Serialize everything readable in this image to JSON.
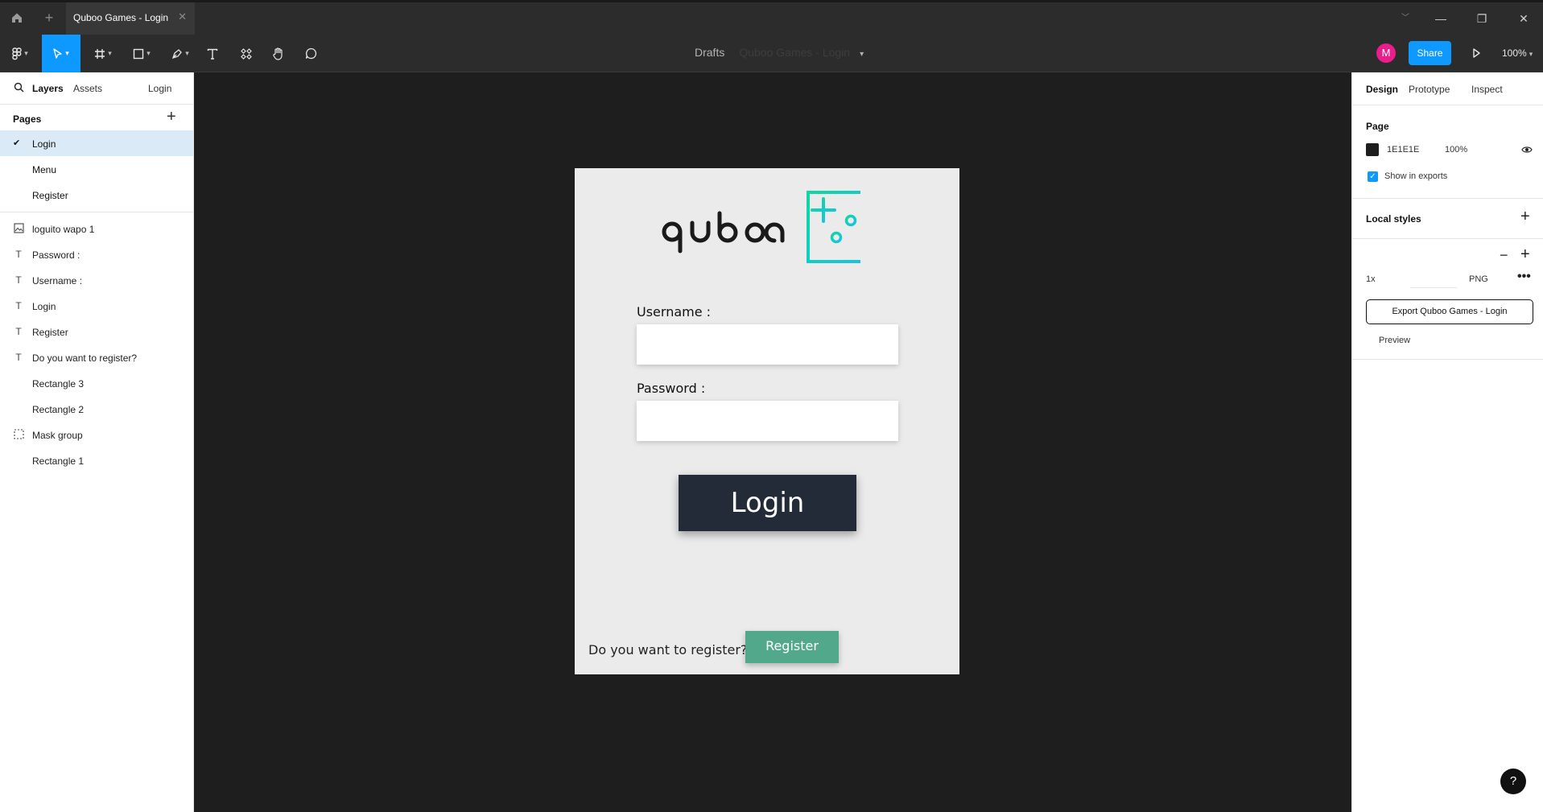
{
  "titlebar": {
    "tab_title": "Quboo Games - Login",
    "tab_close": "✕",
    "new_tab": "+",
    "minimize": "—",
    "restore": "❐",
    "close": "✕"
  },
  "toolbar": {
    "breadcrumb": "Drafts",
    "file_name": "Quboo Games - Login",
    "avatar_initial": "M",
    "share_label": "Share",
    "zoom": "100%"
  },
  "left_panel": {
    "tabs": {
      "layers": "Layers",
      "assets": "Assets",
      "page": "Login"
    },
    "pages_header": "Pages",
    "pages": [
      {
        "label": "Login",
        "selected": true
      },
      {
        "label": "Menu"
      },
      {
        "label": "Register"
      }
    ],
    "layers": [
      {
        "label": "loguito wapo 1",
        "icon": "image-icon"
      },
      {
        "label": "Password :",
        "icon": "text-icon"
      },
      {
        "label": "Username :",
        "icon": "text-icon"
      },
      {
        "label": "Login",
        "icon": "text-icon"
      },
      {
        "label": "Register",
        "icon": "text-icon"
      },
      {
        "label": "Do you want to register?",
        "icon": "text-icon"
      },
      {
        "label": "Rectangle 3",
        "icon": ""
      },
      {
        "label": "Rectangle 2",
        "icon": ""
      },
      {
        "label": "Mask group",
        "icon": "mask-icon"
      },
      {
        "label": "Rectangle 1",
        "icon": ""
      }
    ]
  },
  "frame": {
    "username_label": "Username :",
    "password_label": "Password :",
    "login_button": "Login",
    "register_question": "Do you want to register?",
    "register_button": "Register",
    "background": "#ebebeb"
  },
  "right_panel": {
    "tabs": {
      "design": "Design",
      "prototype": "Prototype",
      "inspect": "Inspect"
    },
    "page_title": "Page",
    "page_color": "1E1E1E",
    "page_opacity": "100%",
    "show_in_exports": "Show in exports",
    "local_styles": "Local styles",
    "export_scale": "1x",
    "export_format": "PNG",
    "export_button": "Export Quboo Games - Login",
    "preview": "Preview"
  },
  "colors": {
    "accent": "#0d99ff",
    "login_button": "#232a38",
    "register_button": "#52a88a",
    "avatar": "#e91e8c"
  }
}
